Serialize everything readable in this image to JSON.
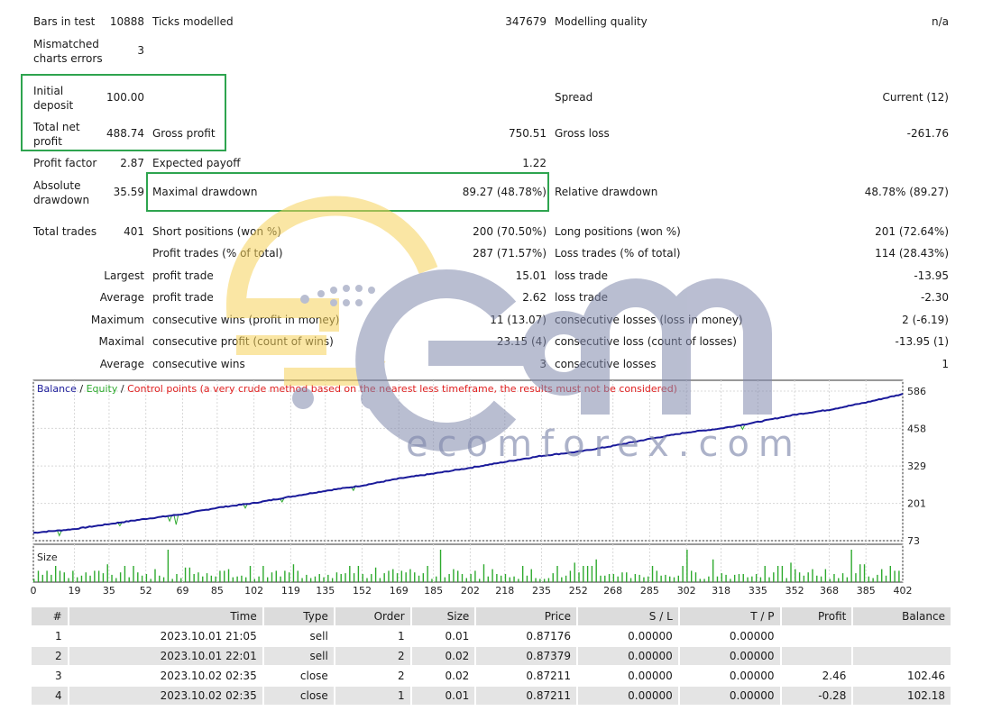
{
  "summary": {
    "bars_in_test_label": "Bars in test",
    "bars_in_test_value": "10888",
    "ticks_modelled_label": "Ticks modelled",
    "ticks_modelled_value": "347679",
    "modelling_quality_label": "Modelling quality",
    "modelling_quality_value": "n/a",
    "mismatched_label": "Mismatched charts errors",
    "mismatched_value": "3",
    "initial_deposit_label": "Initial deposit",
    "initial_deposit_value": "100.00",
    "spread_label": "Spread",
    "spread_value": "Current (12)",
    "total_net_profit_label": "Total net profit",
    "total_net_profit_value": "488.74",
    "gross_profit_label": "Gross profit",
    "gross_profit_value": "750.51",
    "gross_loss_label": "Gross loss",
    "gross_loss_value": "-261.76",
    "profit_factor_label": "Profit factor",
    "profit_factor_value": "2.87",
    "expected_payoff_label": "Expected payoff",
    "expected_payoff_value": "1.22",
    "absolute_drawdown_label": "Absolute drawdown",
    "absolute_drawdown_value": "35.59",
    "maximal_drawdown_label": "Maximal drawdown",
    "maximal_drawdown_value": "89.27 (48.78%)",
    "relative_drawdown_label": "Relative drawdown",
    "relative_drawdown_value": "48.78% (89.27)",
    "total_trades_label": "Total trades",
    "total_trades_value": "401",
    "short_positions_label": "Short positions (won %)",
    "short_positions_value": "200 (70.50%)",
    "long_positions_label": "Long positions (won %)",
    "long_positions_value": "201 (72.64%)",
    "profit_trades_label": "Profit trades (% of total)",
    "profit_trades_value": "287 (71.57%)",
    "loss_trades_label": "Loss trades (% of total)",
    "loss_trades_value": "114 (28.43%)",
    "largest_label": "Largest",
    "largest_profit_label": "profit trade",
    "largest_profit_value": "15.01",
    "largest_loss_label": "loss trade",
    "largest_loss_value": "-13.95",
    "average_label": "Average",
    "average_profit_label": "profit trade",
    "average_profit_value": "2.62",
    "average_loss_label": "loss trade",
    "average_loss_value": "-2.30",
    "maximum_label": "Maximum",
    "max_consec_wins_label": "consecutive wins (profit in money)",
    "max_consec_wins_value": "11 (13.07)",
    "max_consec_losses_label": "consecutive losses (loss in money)",
    "max_consec_losses_value": "2 (-6.19)",
    "maximal_label": "Maximal",
    "maximal_consec_profit_label": "consecutive profit (count of wins)",
    "maximal_consec_profit_value": "23.15 (4)",
    "maximal_consec_loss_label": "consecutive loss (count of losses)",
    "maximal_consec_loss_value": "-13.95 (1)",
    "average2_label": "Average",
    "avg_consec_wins_label": "consecutive wins",
    "avg_consec_wins_value": "3",
    "avg_consec_losses_label": "consecutive losses",
    "avg_consec_losses_value": "1"
  },
  "watermark": {
    "domain": "ecomforex.com"
  },
  "colors": {
    "balance": "#1a1a9a",
    "equity": "#2eaa2e",
    "control": "#e02020",
    "highlight": "#2ea44f",
    "size_bars": "#2eaa2e"
  },
  "chart_data": [
    {
      "type": "line",
      "legend": {
        "balance": "Balance",
        "sep1": " / ",
        "equity": "Equity",
        "sep2": " / ",
        "control": "Control points (a very crude method based on the nearest less timeframe, the results must not be considered)"
      },
      "y_ticks": [
        "586",
        "458",
        "329",
        "201",
        "73"
      ],
      "ylim": [
        73,
        586
      ],
      "x_ticks": [
        "0",
        "19",
        "35",
        "52",
        "69",
        "85",
        "102",
        "119",
        "135",
        "152",
        "169",
        "185",
        "202",
        "218",
        "235",
        "252",
        "268",
        "285",
        "302",
        "318",
        "335",
        "352",
        "368",
        "385",
        "402"
      ],
      "xlim": [
        0,
        402
      ],
      "series": [
        {
          "name": "Balance",
          "x": [
            0,
            19,
            35,
            52,
            69,
            85,
            102,
            119,
            135,
            152,
            169,
            185,
            202,
            218,
            235,
            252,
            268,
            285,
            302,
            318,
            335,
            352,
            368,
            385,
            402
          ],
          "y": [
            100,
            113,
            130,
            148,
            164,
            186,
            202,
            224,
            244,
            262,
            286,
            303,
            323,
            343,
            364,
            378,
            398,
            422,
            444,
            458,
            480,
            505,
            522,
            547,
            576
          ]
        },
        {
          "name": "Equity",
          "dips": [
            [
              12,
              90
            ],
            [
              40,
              124
            ],
            [
              63,
              140
            ],
            [
              66,
              128
            ],
            [
              98,
              185
            ],
            [
              115,
              206
            ],
            [
              123,
              228
            ],
            [
              148,
              245
            ],
            [
              192,
              310
            ],
            [
              197,
              318
            ],
            [
              212,
              335
            ],
            [
              328,
              455
            ],
            [
              368,
              518
            ]
          ]
        }
      ]
    },
    {
      "type": "bar",
      "label": "Size",
      "bars": [
        0.2,
        0.25,
        0.3,
        0.35,
        0.4,
        0.45,
        0.5,
        0.55,
        0.6,
        0.7,
        0.8,
        1.0
      ]
    }
  ],
  "deals_table": {
    "headers": [
      "#",
      "Time",
      "Type",
      "Order",
      "Size",
      "Price",
      "S / L",
      "T / P",
      "Profit",
      "Balance"
    ],
    "rows": [
      [
        "1",
        "2023.10.01 21:05",
        "sell",
        "1",
        "0.01",
        "0.87176",
        "0.00000",
        "0.00000",
        "",
        ""
      ],
      [
        "2",
        "2023.10.01 22:01",
        "sell",
        "2",
        "0.02",
        "0.87379",
        "0.00000",
        "0.00000",
        "",
        ""
      ],
      [
        "3",
        "2023.10.02 02:35",
        "close",
        "2",
        "0.02",
        "0.87211",
        "0.00000",
        "0.00000",
        "2.46",
        "102.46"
      ],
      [
        "4",
        "2023.10.02 02:35",
        "close",
        "1",
        "0.01",
        "0.87211",
        "0.00000",
        "0.00000",
        "-0.28",
        "102.18"
      ]
    ]
  }
}
